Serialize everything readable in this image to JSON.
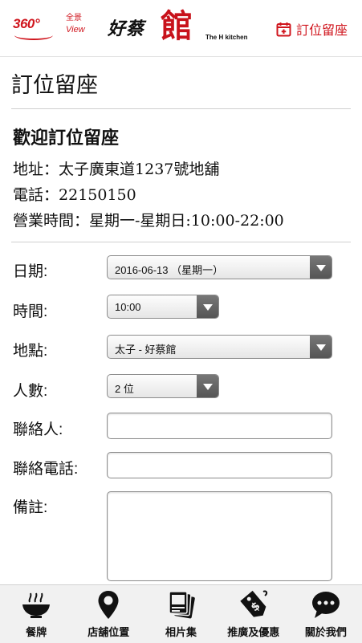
{
  "header": {
    "logo_360": "360°",
    "logo_quanjing": "全景",
    "logo_view": "View",
    "brand_small": "好蔡",
    "brand_big": "館",
    "brand_sub": "The H kitchen",
    "booking_link": "訂位留座"
  },
  "page_title": "訂位留座",
  "info": {
    "welcome": "歡迎訂位留座",
    "address_label": "地址：",
    "address_value": "太子廣東道1237號地舖",
    "phone_label": "電話：",
    "phone_value": "22150150",
    "hours_label": "營業時間：",
    "hours_value": "星期一-星期日:10:00-22:00"
  },
  "form": {
    "date_label": "日期:",
    "date_value": "2016-06-13 （星期一）",
    "time_label": "時間:",
    "time_value": "10:00",
    "location_label": "地點:",
    "location_value": "太子 - 好蔡館",
    "people_label": "人數:",
    "people_value": "2 位",
    "contact_label": "聯絡人:",
    "contact_value": "",
    "contact_phone_label": "聯絡電話:",
    "contact_phone_value": "",
    "notes_label": "備註:",
    "notes_value": ""
  },
  "tabs": [
    {
      "label": "餐牌",
      "icon": "bowl-icon"
    },
    {
      "label": "店舖位置",
      "icon": "map-pin-icon"
    },
    {
      "label": "相片集",
      "icon": "photos-icon"
    },
    {
      "label": "推廣及優惠",
      "icon": "price-tag-icon"
    },
    {
      "label": "關於我們",
      "icon": "chat-bubble-icon"
    }
  ],
  "colors": {
    "brand_red": "#d0161e",
    "tabbar_bg": "#f1f1f1",
    "select_arrow": "#666666"
  }
}
